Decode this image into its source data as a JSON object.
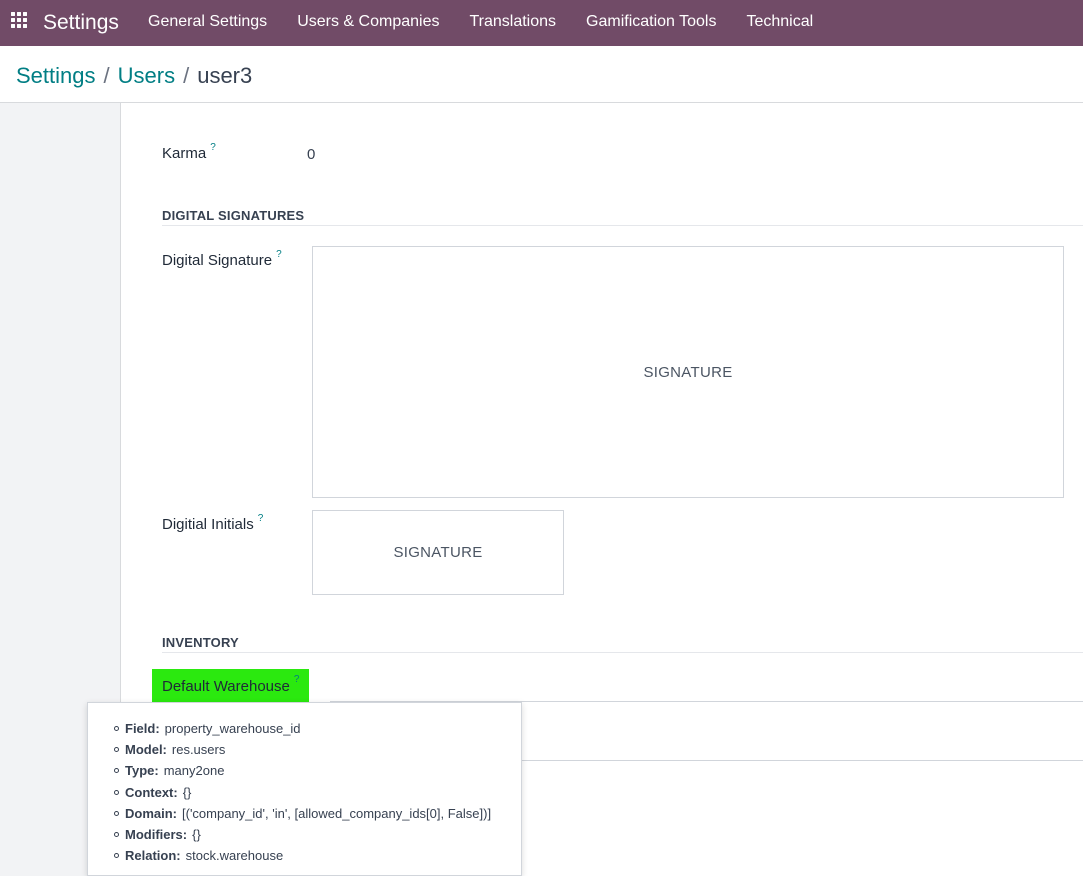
{
  "navbar": {
    "apps_icon": "apps-grid-icon",
    "brand": "Settings",
    "menu": [
      "General Settings",
      "Users & Companies",
      "Translations",
      "Gamification Tools",
      "Technical"
    ],
    "color": "#714B67"
  },
  "breadcrumb": {
    "items": [
      "Settings",
      "Users"
    ],
    "separator": "/",
    "current": "user3"
  },
  "form": {
    "karma_label": "Karma",
    "karma_value": "0",
    "help_mark": "?",
    "digital_signatures": {
      "title": "DIGITAL SIGNATURES",
      "signature_label": "Digital Signature",
      "signature_placeholder": "SIGNATURE",
      "initials_label": "Digitial Initials",
      "initials_placeholder": "SIGNATURE"
    },
    "inventory": {
      "title": "INVENTORY",
      "default_warehouse_label": "Default Warehouse"
    }
  },
  "tooltip": {
    "rows": [
      {
        "key": "Field:",
        "value": "property_warehouse_id"
      },
      {
        "key": "Model:",
        "value": "res.users"
      },
      {
        "key": "Type:",
        "value": "many2one"
      },
      {
        "key": "Context:",
        "value": "{}"
      },
      {
        "key": "Domain:",
        "value": "[('company_id', 'in', [allowed_company_ids[0], False])]"
      },
      {
        "key": "Modifiers:",
        "value": "{}"
      },
      {
        "key": "Relation:",
        "value": "stock.warehouse"
      }
    ]
  },
  "colors": {
    "accent": "#017e84",
    "highlight": "#2be90f"
  }
}
